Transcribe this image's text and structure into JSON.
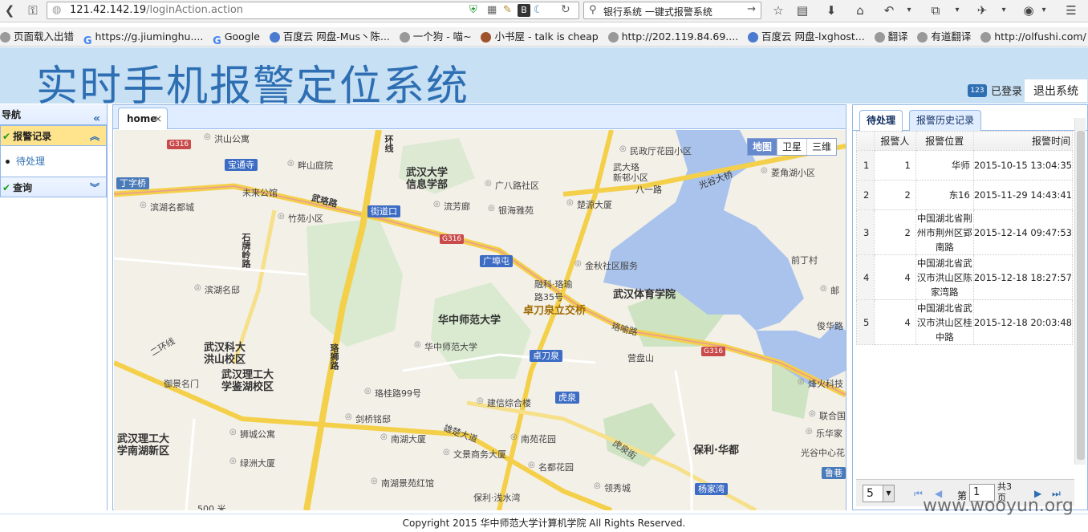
{
  "browser": {
    "url_main": "121.42.142.19",
    "url_path": "/loginAction.action",
    "search_text": "银行系统 一键式报警系统",
    "bookmarks": [
      "页面载入出错",
      "https://g.jiuminghu....",
      "Google",
      "百度云 网盘-Mus丶陈...",
      "一个狗 - 喵~",
      "小书屋 - talk is cheap",
      "http://202.119.84.69....",
      "百度云 网盘-lxghost...",
      "翻译",
      "有道翻译",
      "http://olfushi.com/"
    ]
  },
  "header": {
    "title": "实时手机报警定位系统",
    "login_badge": "123",
    "login_status": "已登录",
    "logout": "退出系统"
  },
  "nav": {
    "title": "导航",
    "sections": [
      {
        "label": "报警记录",
        "items": [
          "待处理"
        ]
      },
      {
        "label": "查询"
      }
    ]
  },
  "center": {
    "tab": "home",
    "map_types": [
      "地图",
      "卫星",
      "三维"
    ],
    "map_labels": {
      "hongshan_park": "洪山公寓",
      "baotongsi": "宝通寺",
      "pan_shan": "畔山庭院",
      "minzhengting": "民政厅花园小区",
      "wuda_luo": "武大珞",
      "xinjiao": "新邨小区",
      "xiaojia": "八一路",
      "guanggu": "光谷大桥",
      "lingjiao": "菱角湖小区",
      "dingzi": "丁字桥",
      "binhu": "滨湖名都城",
      "weilai": "未来公馆",
      "wuhanu_info": "武汉大学信息学部",
      "guangba": "广八路社区",
      "jiedaokou": "街道口",
      "liufang": "流芳廊",
      "yinhai": "银海雅苑",
      "chuxia": "楚源大厦",
      "zhuyuan": "竹苑小区",
      "wuluo": "武珞路",
      "shiba": "石牌岭路",
      "guangbutun": "广埠屯",
      "jinqiu": "金秋社区服务",
      "binhu_ming": "滨湖名邸",
      "rongke": "融科·珞瑜路35号",
      "wuti": "武汉体育学院",
      "zhuodao_li": "卓刀泉立交桥",
      "huashi": "华中师范大学",
      "luoyu": "珞喻路",
      "huashi_small": "华中师范大学",
      "zhuodao": "卓刀泉",
      "yingpan": "营盘山",
      "erhuan": "二环线",
      "wuke": "武汉科大洪山校区",
      "wuli_jian": "武汉理工大学鉴湖校区",
      "yuqing": "御景名门",
      "luoshi": "珞狮路",
      "luogui": "珞桂路99号",
      "jianxin": "建信综合楼",
      "huquan": "虎泉",
      "jianqiao": "剑桥铭邸",
      "xiongchu": "雄楚大道",
      "shicheng": "狮城公寓",
      "nanhu": "南湖大厦",
      "nanwan": "南苑花园",
      "wuli_nanhu": "武汉理工大学南湖新区",
      "lvzhou": "绿洲大厦",
      "wenjing": "文景商务大厦",
      "mingdu": "名都花园",
      "huquan_jie": "虎泉街",
      "baoli": "保利·华都",
      "nanhu_jing": "南湖景苑红馆",
      "lingxiu": "领秀城",
      "baoli_qian": "保利·浅水湾",
      "yangjiawan": "杨家湾",
      "qiandao": "前丁村",
      "junjia": "俊华路",
      "youju": "邮",
      "fenghuo": "烽火科技",
      "lianhe": "联合国",
      "lehua": "乐华家",
      "guanggu_zx": "光谷中心花",
      "luxiang": "鲁巷",
      "scale": "500 米",
      "g316": "G316",
      "huanxian": "环线"
    }
  },
  "right": {
    "tabs": [
      "待处理",
      "报警历史记录"
    ],
    "columns": [
      "",
      "报警人",
      "报警位置",
      "报警时间"
    ],
    "rows": [
      {
        "n": "1",
        "person": "1",
        "location": "华师",
        "time": "2015-10-15 13:04:35"
      },
      {
        "n": "2",
        "person": "2",
        "location": "东16",
        "time": "2015-11-29 14:43:41"
      },
      {
        "n": "3",
        "person": "2",
        "location": "中国湖北省荆州市荆州区郢南路",
        "time": "2015-12-14 09:47:53"
      },
      {
        "n": "4",
        "person": "4",
        "location": "中国湖北省武汉市洪山区陈家湾路",
        "time": "2015-12-18 18:27:57"
      },
      {
        "n": "5",
        "person": "4",
        "location": "中国湖北省武汉市洪山区桂中路",
        "time": "2015-12-18 20:03:48"
      }
    ],
    "pager": {
      "page_size": "5",
      "page_label": "第",
      "page_value": "1",
      "page_total": "共3页"
    }
  },
  "footer": "Copyright 2015 华中师范大学计算机学院 All Rights Reserved.",
  "watermark": "www.wooyun.org"
}
